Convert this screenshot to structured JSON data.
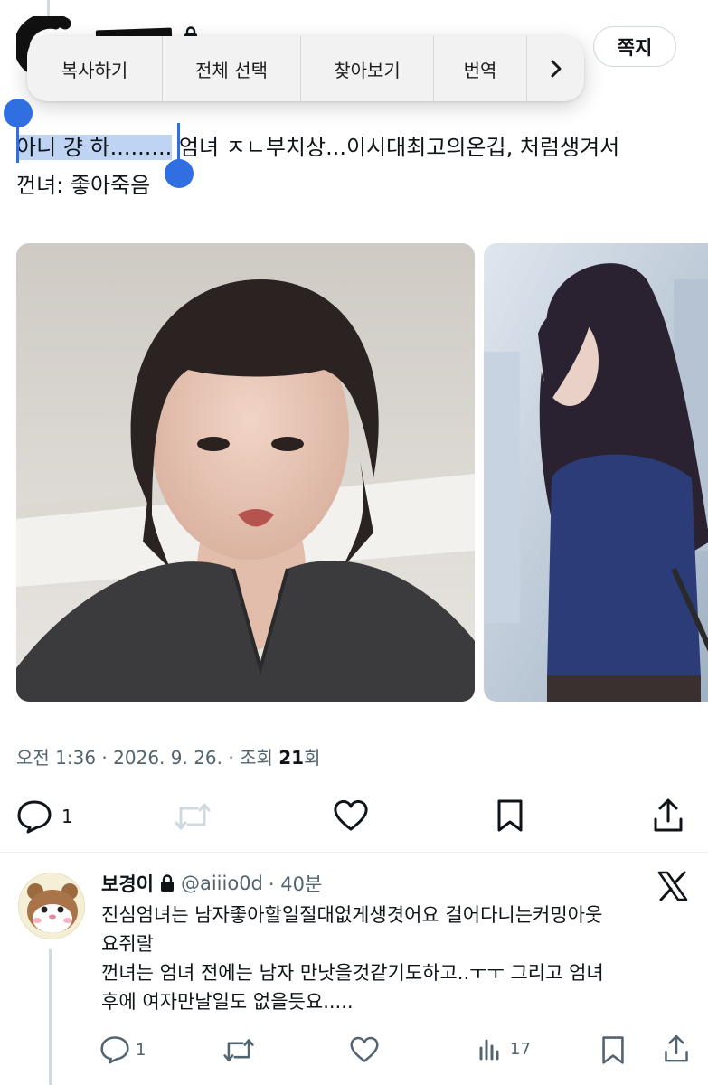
{
  "context_menu": {
    "items": [
      "복사하기",
      "전체 선택",
      "찾아보기",
      "번역"
    ],
    "more_icon": "chevron-right-icon"
  },
  "header": {
    "dm_button_label": "쪽지",
    "lock_icon": "lock-icon"
  },
  "tweet": {
    "text_selected": "아니 걍 하.........",
    "text_line1_rest": " 엄녀 ㅈㄴ부치상...이시대최고의온깁, 처럼생겨서",
    "text_line2": "껀녀: 좋아죽음",
    "timestamp": "오전 1:36 · 2026. 9. 26. · 조회 ",
    "views": "21",
    "views_suffix": "회",
    "reply_count": "1"
  },
  "reply": {
    "name": "보경이",
    "handle": "@aiiio0d",
    "time": " · 40분",
    "lines": [
      "진심엄녀는 남자좋아할일절대없게생겻어요 걸어다니는커밍아웃",
      "요쥐랄",
      "껀녀는 엄녀 전에는 남자 만낫을것같기도하고..ㅜㅜ 그리고 엄녀",
      "후에 여자만날일도 없을듯요....."
    ],
    "reply_count": "1",
    "view_count": "17"
  },
  "colors": {
    "selection": "#bfd4f2",
    "selection_handle": "#2f6fe0",
    "secondary_text": "#536471",
    "divider": "#eff3f4"
  }
}
